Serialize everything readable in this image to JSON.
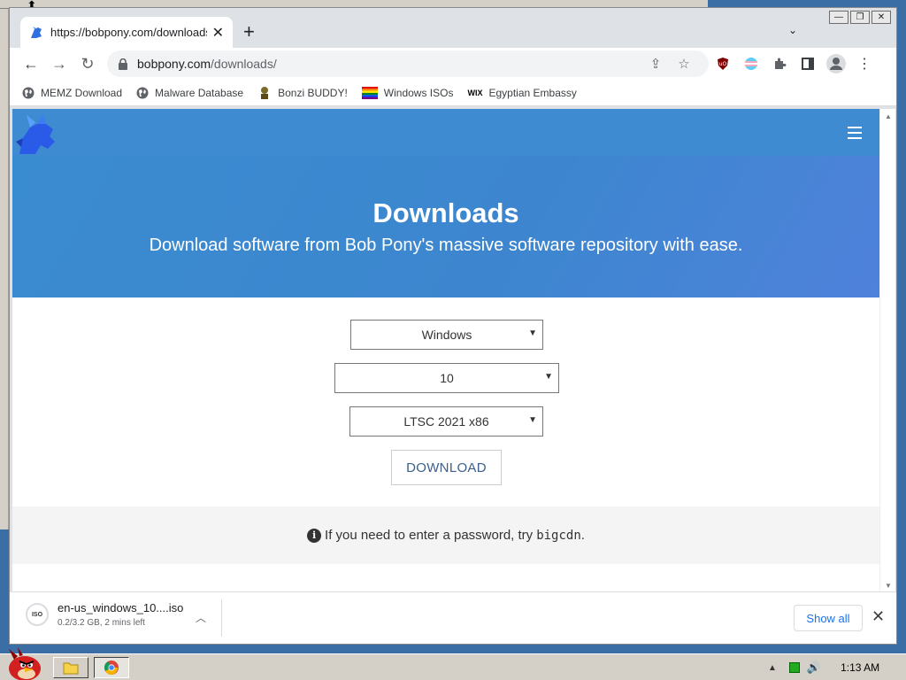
{
  "browser": {
    "tab_title": "https://bobpony.com/downloads",
    "url_host": "bobpony.com",
    "url_path": "/downloads/",
    "window_controls": [
      "minimize",
      "restore",
      "close"
    ]
  },
  "bookmarks": [
    {
      "label": "MEMZ Download",
      "icon": "globe-icon"
    },
    {
      "label": "Malware Database",
      "icon": "globe-icon"
    },
    {
      "label": "Bonzi BUDDY!",
      "icon": "bonzi-icon"
    },
    {
      "label": "Windows ISOs",
      "icon": "rainbow-flag-icon"
    },
    {
      "label": "Egyptian Embassy",
      "icon": "wix-icon"
    }
  ],
  "hero": {
    "title": "Downloads",
    "subtitle": "Download software from Bob Pony's massive software repository with ease."
  },
  "form": {
    "os_selected": "Windows",
    "version_selected": "10",
    "edition_selected": "LTSC 2021 x86",
    "download_label": "DOWNLOAD"
  },
  "info": {
    "text": "If you need to enter a password, try",
    "password": "bigcdn",
    "suffix": "."
  },
  "download_shelf": {
    "file_name": "en-us_windows_10....iso",
    "status": "0.2/3.2 GB, 2 mins left",
    "icon_text": "ISO",
    "show_all_label": "Show all"
  },
  "taskbar": {
    "clock": "1:13 AM"
  },
  "colors": {
    "hero_blue": "#3d86cf",
    "link_blue": "#1a73e8",
    "button_text": "#3b5e8c"
  }
}
